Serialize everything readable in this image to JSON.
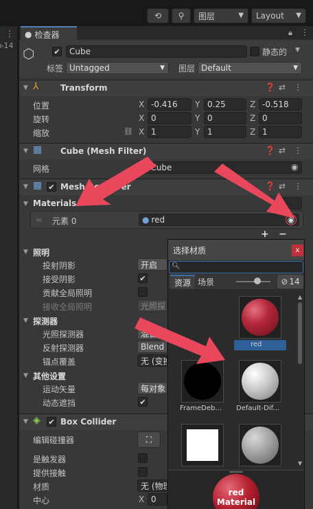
{
  "toolbar": {
    "history_icon": "history-icon",
    "search_icon": "search-icon",
    "layers_label": "图层",
    "layout_label": "Layout"
  },
  "left_panel": {
    "count": "14"
  },
  "inspector": {
    "tab_label": "检查器",
    "object": {
      "name": "Cube",
      "static_label": "静态的",
      "tag_label": "标签",
      "tag_value": "Untagged",
      "layer_label": "图层",
      "layer_value": "Default"
    },
    "transform": {
      "title": "Transform",
      "position_label": "位置",
      "rotation_label": "旋转",
      "scale_label": "缩放",
      "position": {
        "x": "-0.416",
        "y": "0.25",
        "z": "-0.518"
      },
      "rotation": {
        "x": "0",
        "y": "0",
        "z": "0"
      },
      "scale": {
        "x": "1",
        "y": "1",
        "z": "1"
      }
    },
    "mesh_filter": {
      "title": "Cube (Mesh Filter)",
      "mesh_label": "网格",
      "mesh_value": "Cube"
    },
    "mesh_renderer": {
      "title": "Mesh Renderer",
      "materials_label": "Materials",
      "element_label": "元素 0",
      "element_value": "red",
      "lighting_label": "照明",
      "cast_shadows_label": "投射阴影",
      "cast_shadows_value": "开启",
      "receive_shadows_label": "接受阴影",
      "contribute_gi_label": "贡献全局照明",
      "receive_gi_label": "接收全局照明",
      "receive_gi_value": "光照探",
      "probes_label": "探测器",
      "light_probes_label": "光照探测器",
      "light_probes_value": "混合探",
      "reflection_probes_label": "反射探测器",
      "reflection_probes_value": "Blend",
      "anchor_override_label": "锚点覆盖",
      "anchor_override_value": "无 (变换",
      "additional_label": "其他设置",
      "motion_vectors_label": "运动矢量",
      "motion_vectors_value": "每对象",
      "dynamic_occlusion_label": "动态遮挡"
    },
    "box_collider": {
      "title": "Box Collider",
      "edit_label": "编辑碰撞器",
      "is_trigger_label": "是触发器",
      "provides_contacts_label": "提供接触",
      "material_label": "材质",
      "material_value": "无 (物理",
      "center_label": "中心",
      "center_x": "0"
    }
  },
  "material_picker": {
    "title": "选择材质",
    "search_placeholder": "",
    "tab_assets": "资源",
    "tab_scene": "场景",
    "hidden_count": "14",
    "items": [
      {
        "name": "red"
      },
      {
        "name": "FrameDeb..."
      },
      {
        "name": "Default-Dif..."
      },
      {
        "name": ""
      },
      {
        "name": ""
      }
    ],
    "preview_line1": "red",
    "preview_line2": "Material"
  },
  "colors": {
    "accent": "#3d6ea8",
    "close": "#c0303a",
    "arrow": "#e8475c",
    "red_material": "#a8202e"
  }
}
